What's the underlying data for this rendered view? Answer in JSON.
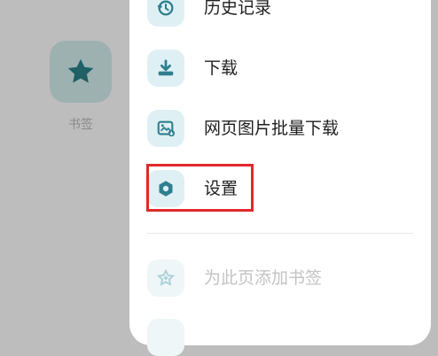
{
  "background": {
    "bookmarks_tile": {
      "icon": "star-icon",
      "label": "书签"
    }
  },
  "menu": {
    "items": [
      {
        "icon": "history-icon",
        "label": "历史记录",
        "enabled": true
      },
      {
        "icon": "download-icon",
        "label": "下载",
        "enabled": true
      },
      {
        "icon": "image-batch-download-icon",
        "label": "网页图片批量下载",
        "enabled": true
      },
      {
        "icon": "settings-icon",
        "label": "设置",
        "enabled": true,
        "highlighted": true
      },
      {
        "icon": "add-bookmark-icon",
        "label": "为此页添加书签",
        "enabled": false
      }
    ]
  },
  "colors": {
    "accent": "#2f7f8f",
    "icon_tile_bg": "#dff0f4",
    "highlight_border": "#e0292c",
    "disabled_text": "#c3c3c3"
  }
}
